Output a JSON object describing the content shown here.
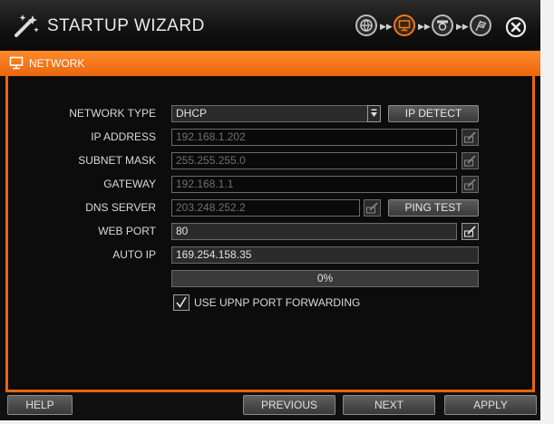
{
  "window": {
    "title": "STARTUP WIZARD",
    "icons": [
      "magic-wand-icon",
      "globe-step-icon",
      "network-step-icon",
      "camera-step-icon",
      "finish-flag-icon",
      "close-icon"
    ]
  },
  "section": {
    "title": "NETWORK",
    "icon": "monitor-icon"
  },
  "form": {
    "network_type": {
      "label": "NETWORK TYPE",
      "value": "DHCP",
      "button": "IP DETECT"
    },
    "ip_address": {
      "label": "IP ADDRESS",
      "value": "192.168.1.202"
    },
    "subnet_mask": {
      "label": "SUBNET MASK",
      "value": "255.255.255.0"
    },
    "gateway": {
      "label": "GATEWAY",
      "value": "192.168.1.1"
    },
    "dns_server": {
      "label": "DNS SERVER",
      "value": "203.248.252.2",
      "button": "PING TEST"
    },
    "web_port": {
      "label": "WEB PORT",
      "value": "80"
    },
    "auto_ip": {
      "label": "AUTO IP",
      "value": "169.254.158.35"
    },
    "progress": {
      "text": "0%",
      "value": 0
    },
    "upnp": {
      "label": "USE UPNP PORT FORWARDING",
      "checked": true
    }
  },
  "footer": {
    "help": "HELP",
    "previous": "PREVIOUS",
    "next": "NEXT",
    "apply": "APPLY"
  },
  "colors": {
    "accent": "#f07a1c",
    "background": "#0c0c0c",
    "text": "#d9d9d9"
  }
}
